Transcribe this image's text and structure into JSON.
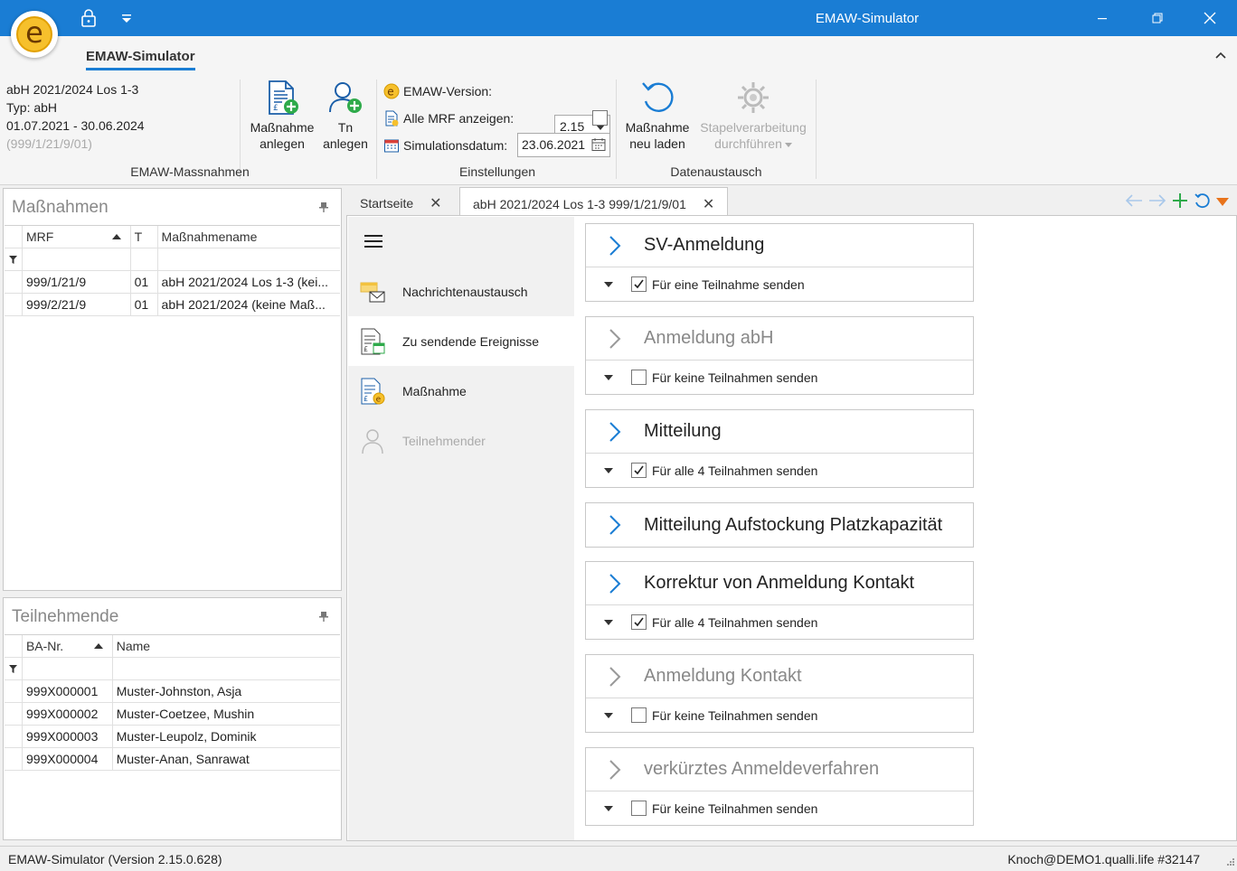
{
  "window": {
    "title": "EMAW-Simulator"
  },
  "ribbon": {
    "tab": "EMAW-Simulator",
    "info": {
      "line1": "abH 2021/2024 Los 1-3",
      "line2": "Typ: abH",
      "line3": "01.07.2021 - 30.06.2024",
      "line4": "(999/1/21/9/01)"
    },
    "groups": {
      "massnahmen": "EMAW-Massnahmen",
      "einstellungen": "Einstellungen",
      "datenaustausch": "Datenaustausch"
    },
    "buttons": {
      "massnahme_anlegen_1": "Maßnahme",
      "massnahme_anlegen_2": "anlegen",
      "tn_anlegen_1": "Tn",
      "tn_anlegen_2": "anlegen",
      "neu_laden_1": "Maßnahme",
      "neu_laden_2": "neu laden",
      "stapel_1": "Stapelverarbeitung",
      "stapel_2": "durchführen"
    },
    "settings": {
      "version_label": "EMAW-Version:",
      "version_value": "2.15",
      "mrf_label": "Alle MRF anzeigen:",
      "datum_label": "Simulationsdatum:",
      "datum_value": "23.06.2021"
    }
  },
  "massnahmen_panel": {
    "title": "Maßnahmen",
    "columns": [
      "MRF",
      "T",
      "Maßnahmename"
    ],
    "rows": [
      {
        "mrf": "999/1/21/9",
        "t": "01",
        "name": "abH 2021/2024 Los 1-3 (kei..."
      },
      {
        "mrf": "999/2/21/9",
        "t": "01",
        "name": "abH 2021/2024 (keine Maß..."
      }
    ]
  },
  "teilnehmende_panel": {
    "title": "Teilnehmende",
    "columns": [
      "BA-Nr.",
      "Name"
    ],
    "rows": [
      {
        "ba": "999X000001",
        "name": "Muster-Johnston, Asja"
      },
      {
        "ba": "999X000002",
        "name": "Muster-Coetzee, Mushin"
      },
      {
        "ba": "999X000003",
        "name": "Muster-Leupolz, Dominik"
      },
      {
        "ba": "999X000004",
        "name": "Muster-Anan, Sanrawat"
      }
    ]
  },
  "tabs": {
    "startseite": "Startseite",
    "active": "abH 2021/2024 Los 1-3 999/1/21/9/01"
  },
  "leftnav": {
    "items": [
      {
        "label": "Nachrichtenaustausch"
      },
      {
        "label": "Zu sendende Ereignisse"
      },
      {
        "label": "Maßnahme"
      },
      {
        "label": "Teilnehmender"
      }
    ]
  },
  "events": [
    {
      "title": "SV-Anmeldung",
      "sub": "Für eine Teilnahme senden",
      "checked": true,
      "dim": false
    },
    {
      "title": "Anmeldung abH",
      "sub": "Für keine Teilnahmen senden",
      "checked": false,
      "dim": true
    },
    {
      "title": "Mitteilung",
      "sub": "Für alle 4 Teilnahmen senden",
      "checked": true,
      "dim": false
    },
    {
      "title": "Mitteilung Aufstockung Platzkapazität",
      "sub": null,
      "checked": false,
      "dim": false
    },
    {
      "title": "Korrektur von Anmeldung Kontakt",
      "sub": "Für alle 4 Teilnahmen senden",
      "checked": true,
      "dim": false
    },
    {
      "title": "Anmeldung Kontakt",
      "sub": "Für keine Teilnahmen senden",
      "checked": false,
      "dim": true
    },
    {
      "title": "verkürztes Anmeldeverfahren",
      "sub": "Für keine Teilnahmen senden",
      "checked": false,
      "dim": true
    }
  ],
  "status": {
    "left": "EMAW-Simulator (Version 2.15.0.628)",
    "right": "Knoch@DEMO1.qualli.life #32147"
  },
  "colors": {
    "accent": "#1a7dd4",
    "add": "#2eaa4a",
    "orange": "#e8731b"
  }
}
